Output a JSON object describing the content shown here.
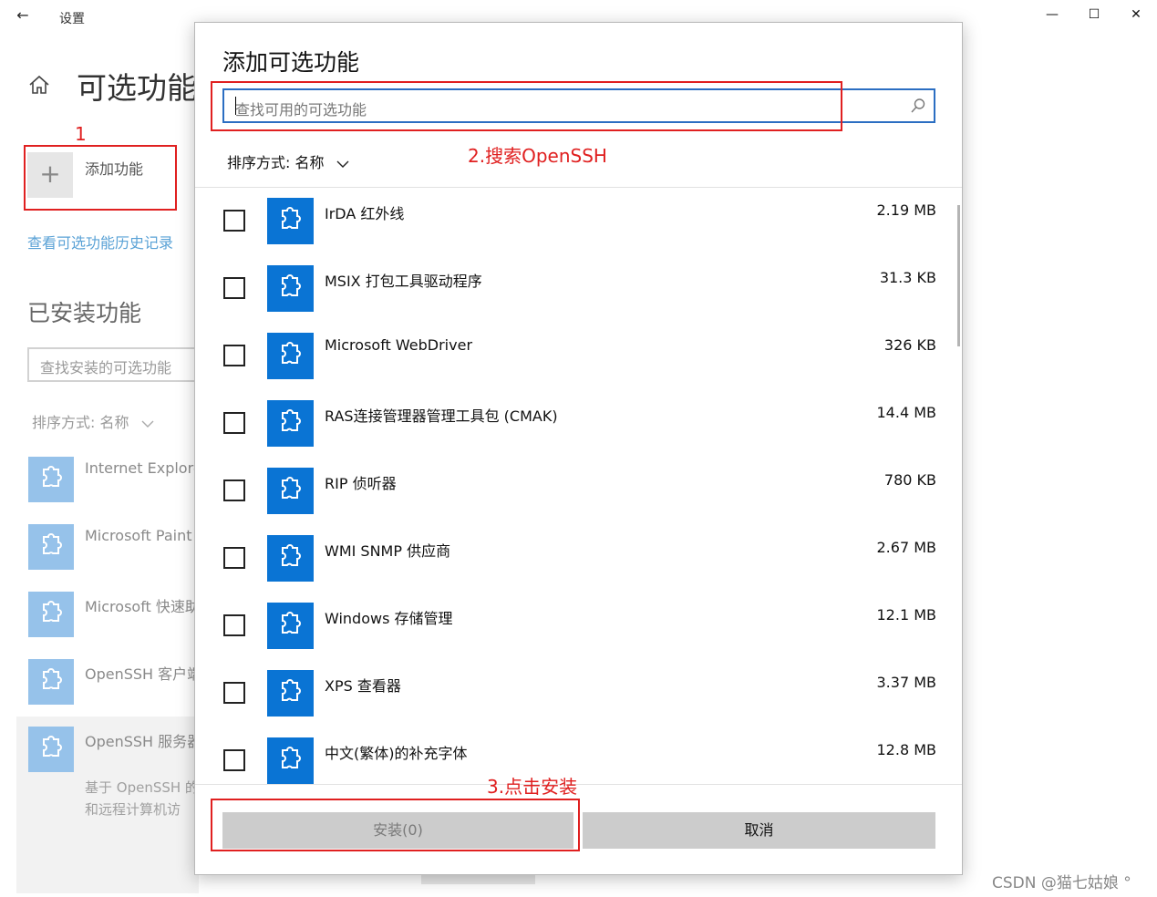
{
  "window": {
    "back_glyph": "←",
    "title": "设置",
    "minimize_glyph": "—",
    "maximize_glyph": "☐",
    "close_glyph": "✕"
  },
  "settings": {
    "page_title": "可选功能",
    "add_plus": "+",
    "add_feature_label": "添加功能",
    "history_link": "查看可选功能历史记录",
    "installed_title": "已安装功能",
    "installed_search_placeholder": "查找安装的可选功能",
    "sort_label": "排序方式: 名称",
    "installed_items": [
      {
        "name": "Internet Explore"
      },
      {
        "name": "Microsoft Paint"
      },
      {
        "name": "Microsoft 快速助"
      },
      {
        "name": "OpenSSH 客户端"
      },
      {
        "name": "OpenSSH 服务器"
      }
    ],
    "selected_description_line1": "基于 OpenSSH 的",
    "selected_description_line2": "和远程计算机访"
  },
  "dialog": {
    "title": "添加可选功能",
    "search_placeholder": "查找可用的可选功能",
    "sort_label": "排序方式: 名称",
    "features": [
      {
        "name": "IrDA 红外线",
        "size": "2.19 MB"
      },
      {
        "name": "MSIX 打包工具驱动程序",
        "size": "31.3 KB"
      },
      {
        "name": "Microsoft WebDriver",
        "size": "326 KB"
      },
      {
        "name": "RAS连接管理器管理工具包 (CMAK)",
        "size": "14.4 MB"
      },
      {
        "name": "RIP 侦听器",
        "size": "780 KB"
      },
      {
        "name": "WMI SNMP 供应商",
        "size": "2.67 MB"
      },
      {
        "name": "Windows 存储管理",
        "size": "12.1 MB"
      },
      {
        "name": "XPS 查看器",
        "size": "3.37 MB"
      },
      {
        "name": "中文(繁体)的补充字体",
        "size": "12.8 MB"
      }
    ],
    "install_button": "安装(0)",
    "cancel_button": "取消"
  },
  "annotations": {
    "step1": "1",
    "step2": "2.搜索OpenSSH",
    "step3": "3.点击安装",
    "color": "#e02020"
  },
  "watermark": "CSDN @猫七姑娘 °",
  "colors": {
    "accent": "#0a74d4",
    "link": "#5aa2d6",
    "search_border": "#2b6ec2",
    "button_bg": "#cccccc"
  },
  "icons": {
    "feature": "puzzle-icon",
    "home": "home-icon",
    "search": "search-icon",
    "sort": "chevron-down-icon"
  }
}
